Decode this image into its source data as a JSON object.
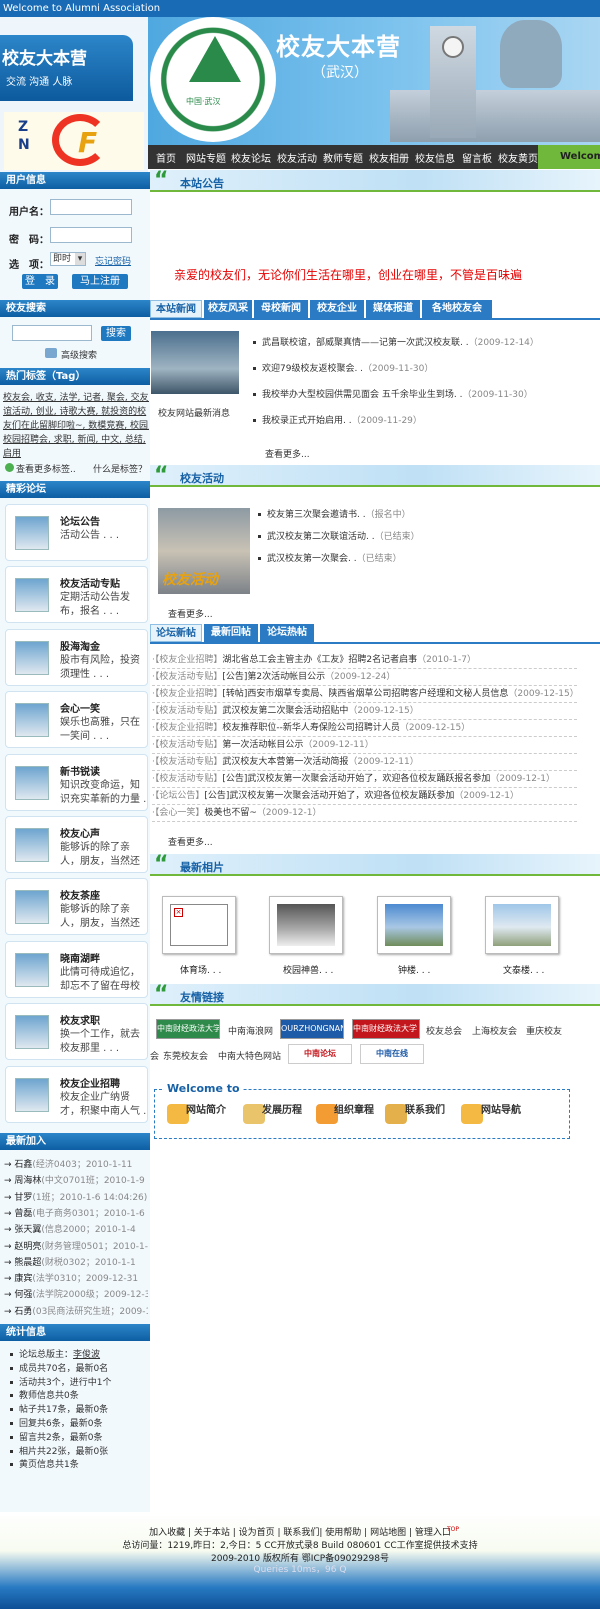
{
  "top_strip": "Welcome to Alumni Association",
  "brand": {
    "title": "校友大本营",
    "subtitle": "交流  沟通  人脉",
    "logo_letters": "Z N"
  },
  "banner": {
    "title": "校友大本营",
    "subtitle": "（武汉）",
    "seal_text": "中国·武汉"
  },
  "nav": [
    "首页",
    "网站专题",
    "校友论坛",
    "校友活动",
    "教师专题",
    "校友相册",
    "校友信息",
    "留言板",
    "校友黄页"
  ],
  "nav_welcome": "Welcome",
  "user_info": {
    "title": "用户信息",
    "username_label": "用户名：",
    "password_label": "密　码：",
    "option_label": "选　项：",
    "option_value": "即时",
    "remember": "忘记密码",
    "login": "登　录",
    "register": "马上注册"
  },
  "search": {
    "title": "校友搜索",
    "button": "搜索",
    "advanced": "高级搜索"
  },
  "tags": {
    "title": "热门标签（Tag）",
    "lines": [
      "校友会, 收支, 法学, 记者, 聚会, 交友, 联",
      "谊活动, 创业, 诗歌大赛, 就投资的校",
      "友们在此留脚印啦~, 数模竞赛, 校园,",
      "校园招聘会, 求职, 新闻, 中文, 总结,",
      "启用"
    ],
    "more": "查看更多标签..",
    "what": "什么是标签？"
  },
  "forum": {
    "title": "精彩论坛",
    "items": [
      {
        "t": "论坛公告",
        "d": "活动公告 . . ."
      },
      {
        "t": "校友活动专贴",
        "d": "定期活动公告发布，报名 . . ."
      },
      {
        "t": "股海淘金",
        "d": "股市有风险，投资须理性 . . ."
      },
      {
        "t": "会心一笑",
        "d": "娱乐也高雅，只在一笑间 . . ."
      },
      {
        "t": "新书锐读",
        "d": "知识改变命运，知识充实革新的力量 . . ."
      },
      {
        "t": "校友心声",
        "d": "能够诉的除了亲人，朋友，当然还有校友 . . ."
      },
      {
        "t": "校友茶座",
        "d": "能够诉的除了亲人，朋友，当然还有校友 . . ."
      },
      {
        "t": "晓南湖畔",
        "d": "此情可待成追忆，却忘不了留在母校里的足迹 . . ."
      },
      {
        "t": "校友求职",
        "d": "换一个工作，就去校友那里 . . ."
      },
      {
        "t": "校友企业招聘",
        "d": "校友企业广纳贤才，积聚中南人气 . . ."
      }
    ]
  },
  "new_members": {
    "title": "最新加入",
    "items": [
      {
        "n": "→ 石鑫",
        "i": "(经济0403；2010-1-11"
      },
      {
        "n": "→ 周海林",
        "i": "(中文0701班；2010-1-9"
      },
      {
        "n": "→ 甘罗",
        "i": "(1班；2010-1-6 14:04:26)"
      },
      {
        "n": "→ 曾磊",
        "i": "(电子商务0301；2010-1-6"
      },
      {
        "n": "→ 张天翼",
        "i": "(信息2000；2010-1-4"
      },
      {
        "n": "→ 赵明亮",
        "i": "(财务管理0501；2010-1-3"
      },
      {
        "n": "→ 熊晨超",
        "i": "(财税0302；2010-1-1"
      },
      {
        "n": "→ 康宾",
        "i": "(法学0310；2009-12-31"
      },
      {
        "n": "→ 何强",
        "i": "(法学院2000级；2009-12-31"
      },
      {
        "n": "→ 石勇",
        "i": "(03民商法研究生班；2009-12"
      }
    ]
  },
  "stats": {
    "title": "统计信息",
    "items": [
      "论坛总版主：",
      "成员共70名，最新0名",
      "活动共3个，进行中1个",
      "教师信息共0条",
      "帖子共17条，最新0条",
      "回复共6条，最新0条",
      "留言共2条，最新0条",
      "相片共22张，最新0张",
      "黄页信息共1条"
    ],
    "admin": "李俊波"
  },
  "notice": {
    "title": "本站公告",
    "text": "亲爱的校友们，无论你们生活在哪里，创业在哪里，不管是百味遍"
  },
  "news_tabs": [
    "本站新闻",
    "校友风采",
    "母校新闻",
    "校友企业",
    "媒体报道",
    "各地校友会"
  ],
  "news": {
    "caption": "校友网站最新消息",
    "more": "查看更多...",
    "items": [
      {
        "t": "武昌联校谊，部威聚真情——记第一次武汉校友联. .",
        "d": "（2009-12-14）"
      },
      {
        "t": "欢迎79级校友返校聚会. .",
        "d": "（2009-11-30）"
      },
      {
        "t": "我校举办大型校园供需见面会 五千余毕业生到场. .",
        "d": "（2009-11-30）"
      },
      {
        "t": "我校录正式开始启用. .",
        "d": "（2009-11-29）"
      }
    ]
  },
  "activities": {
    "title": "校友活动",
    "caption": "校友活动",
    "more": "查看更多...",
    "items": [
      {
        "t": "校友第三次聚会邀请书. .",
        "d": "（报名中）"
      },
      {
        "t": "武汉校友第二次联谊活动. .",
        "d": "（已结束）"
      },
      {
        "t": "武汉校友第一次聚会. .",
        "d": "（已结束）"
      }
    ]
  },
  "forum_tabs": [
    "论坛新帖",
    "最新回帖",
    "论坛热帖"
  ],
  "forum_posts": {
    "more": "查看更多...",
    "items": [
      {
        "c": "·【校友企业招聘】",
        "t": "湖北省总工会主管主办《工友》招聘2名记者启事",
        "d": "（2010-1-7）"
      },
      {
        "c": "·【校友活动专贴】",
        "t": "[公告]第2次活动帐目公示",
        "d": "（2009-12-24）"
      },
      {
        "c": "·【校友企业招聘】",
        "t": "[转帖]西安市烟草专卖局、陕西省烟草公司招聘客户经理和文秘人员信息",
        "d": "（2009-12-15）"
      },
      {
        "c": "·【校友活动专贴】",
        "t": "武汉校友第二次聚会活动招贴中",
        "d": "（2009-12-15）"
      },
      {
        "c": "·【校友企业招聘】",
        "t": "校友推荐职位--新华人寿保险公司招聘计人员",
        "d": "（2009-12-15）"
      },
      {
        "c": "·【校友活动专贴】",
        "t": "第一次活动帐目公示",
        "d": "（2009-12-11）"
      },
      {
        "c": "·【校友活动专贴】",
        "t": "武汉校友大本营第一次活动简报",
        "d": "（2009-12-11）"
      },
      {
        "c": "·【校友活动专贴】",
        "t": "[公告]武汉校友第一次聚会活动开始了，欢迎各位校友踊跃报名参加",
        "d": "（2009-12-1）"
      },
      {
        "c": "·【论坛公告】",
        "t": "[公告]武汉校友第一次聚会活动开始了，欢迎各位校友踊跃参加",
        "d": "（2009-12-1）"
      },
      {
        "c": "·【会心一笑】",
        "t": "极美也不留~",
        "d": "（2009-12-1）"
      }
    ]
  },
  "photos": {
    "title": "最新相片",
    "items": [
      "体育场. . .",
      "校园神兽. . .",
      "钟楼. . .",
      "文泰楼. . ."
    ]
  },
  "links": {
    "title": "友情链接",
    "text_links": [
      "中南海浪网",
      "校友总会",
      "上海校友会",
      "重庆校友",
      "会",
      "东莞校友会",
      "中南大特色网站"
    ],
    "logos": [
      "中南财经政法大学",
      "OURZHONGNAN.COM",
      "中南财经政法大学 广州校友会",
      "中南论坛",
      "中南在线"
    ]
  },
  "welcome": {
    "title": "Welcome to",
    "items": [
      "网站简介",
      "发展历程",
      "组织章程",
      "联系我们",
      "网站导航"
    ]
  },
  "footer": {
    "links": "加入收藏 | 关于本站 | 设为首页 | 联系我们| 使用帮助 | 网站地图 | 管理入口",
    "top": "TOP",
    "line2": "总访问量：1219,昨日：2,今日：5 CC开放式录8 Build 080601 CC工作室提供技术支持",
    "line3": "2009-2010 版权所有 鄂ICP备09029298号",
    "line4": "Queries 10ms，96 Q"
  },
  "colors": {
    "accent": "#1a6bb5",
    "green": "#6fb83b",
    "notice_red": "#e60000"
  }
}
